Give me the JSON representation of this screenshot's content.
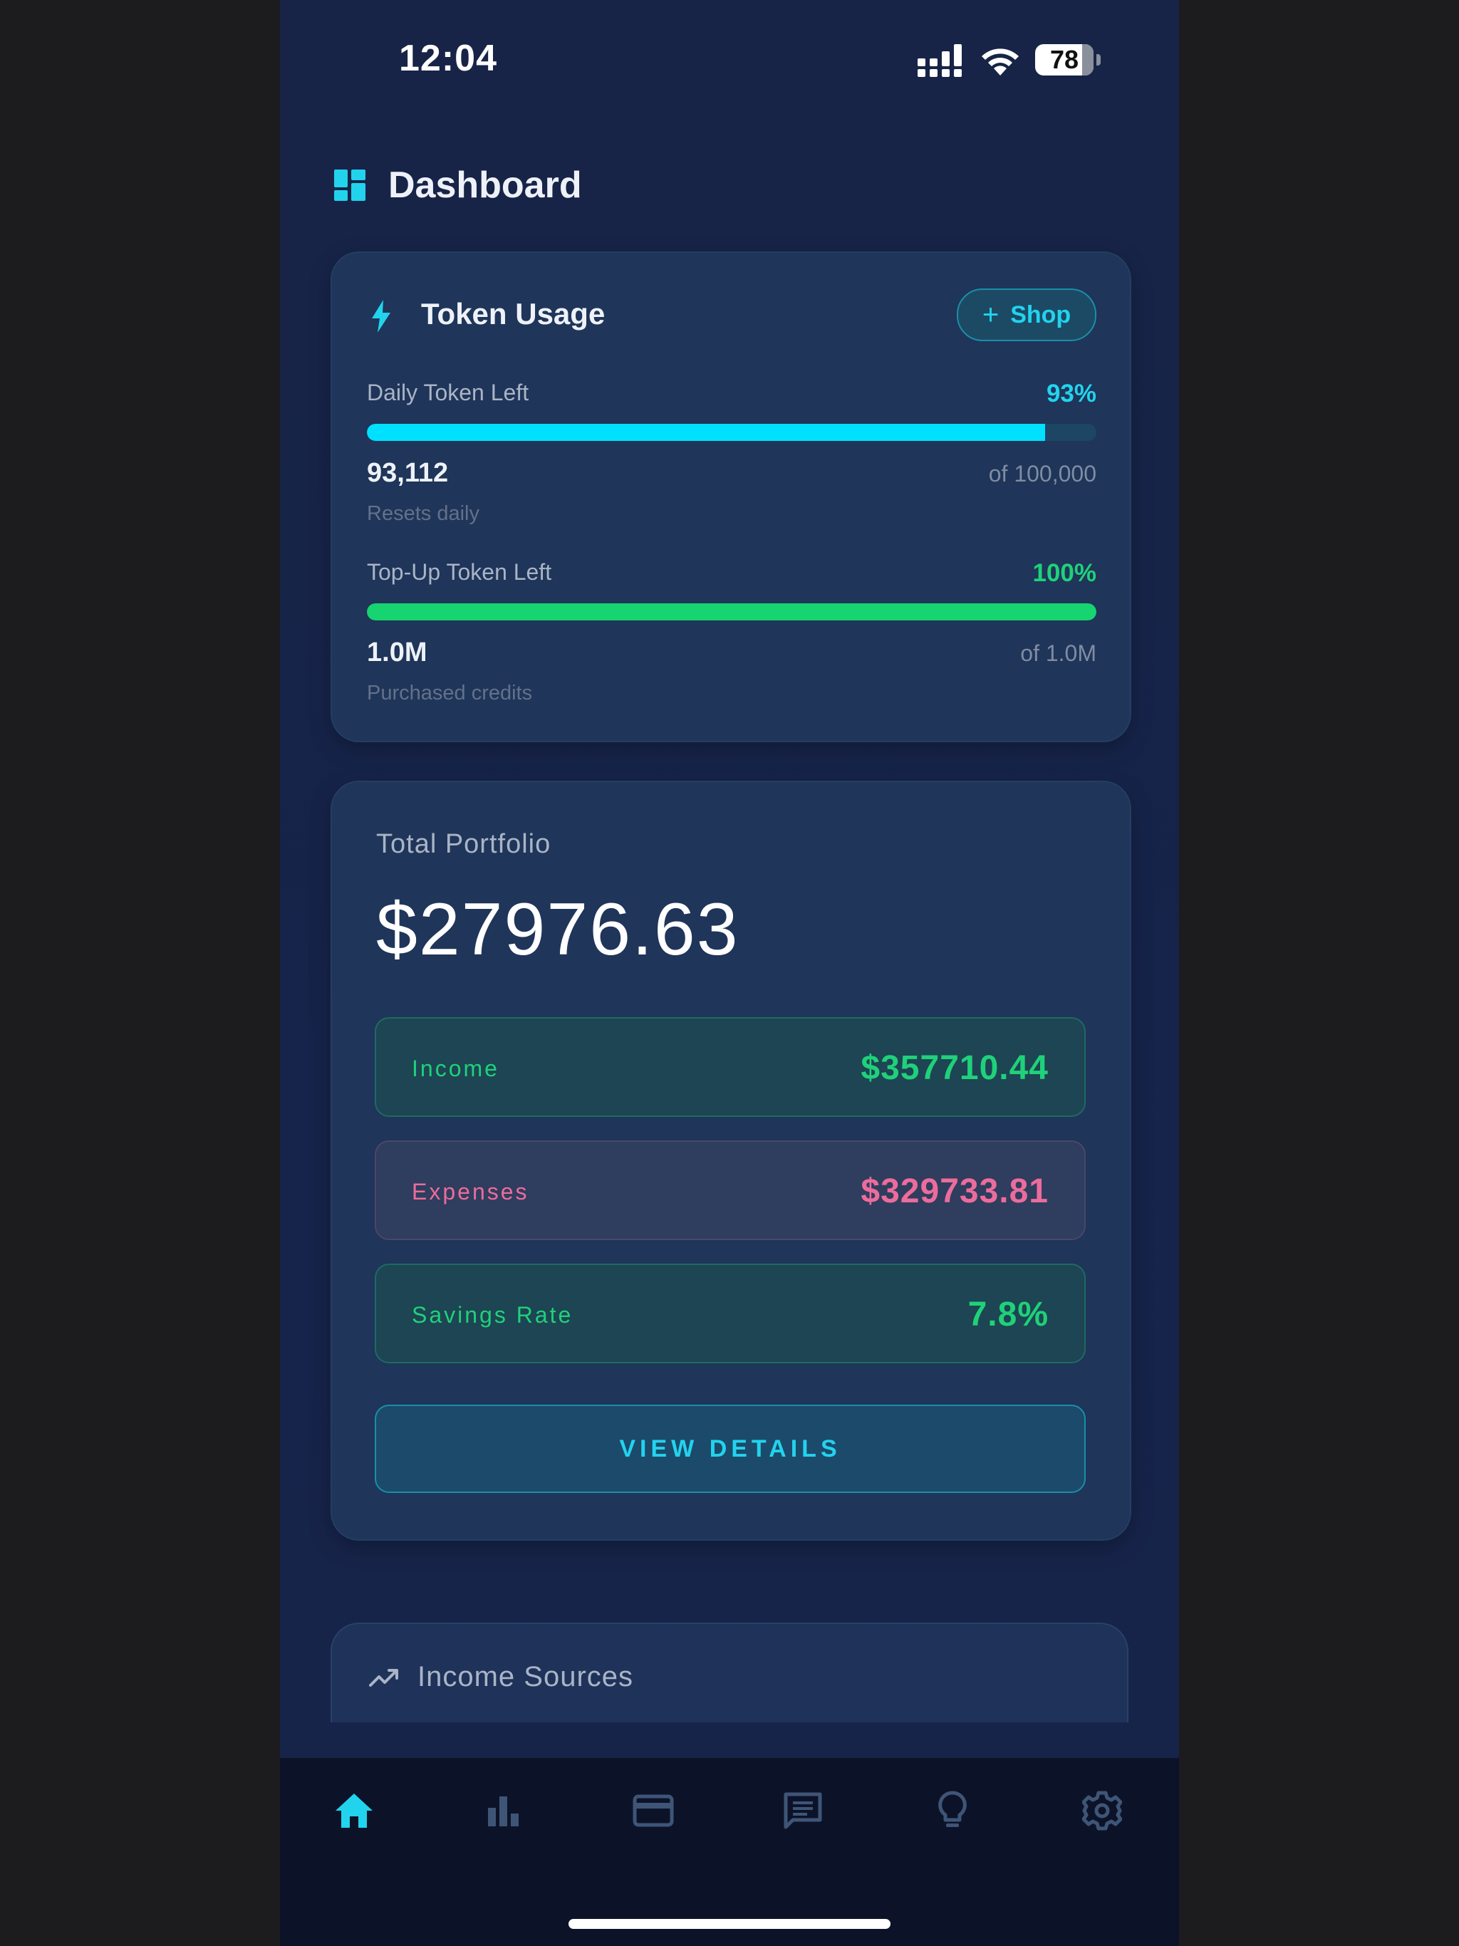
{
  "status_bar": {
    "time": "12:04",
    "battery": "78"
  },
  "header": {
    "title": "Dashboard",
    "icon": "dashboard-icon"
  },
  "token_card": {
    "title": "Token Usage",
    "icon": "bolt-icon",
    "shop_label": "Shop",
    "daily": {
      "label": "Daily Token Left",
      "percent_text": "93%",
      "fill_fraction": 0.93,
      "value": "93,112",
      "of": "of 100,000",
      "sub": "Resets daily"
    },
    "topup": {
      "label": "Top-Up Token Left",
      "percent_text": "100%",
      "fill_fraction": 1.0,
      "value": "1.0M",
      "of": "of 1.0M",
      "sub": "Purchased credits"
    }
  },
  "portfolio": {
    "label": "Total Portfolio",
    "value": "$27976.63",
    "stats": [
      {
        "label": "Income",
        "value": "$357710.44"
      },
      {
        "label": "Expenses",
        "value": "$329733.81"
      },
      {
        "label": "Savings Rate",
        "value": "7.8%"
      }
    ],
    "details_label": "VIEW DETAILS"
  },
  "income_sources": {
    "title": "Income Sources",
    "icon": "trending-up-icon"
  },
  "nav": {
    "items": [
      "home-icon",
      "bar-chart-icon",
      "credit-card-icon",
      "chat-icon",
      "lightbulb-icon",
      "settings-icon"
    ],
    "active": "home-icon"
  },
  "colors": {
    "accent_cyan": "#22d3ee",
    "accent_green": "#1fd17a",
    "accent_pink": "#ec6c9c",
    "bar_cyan": "#00e1ff",
    "bar_green": "#16d46f"
  }
}
